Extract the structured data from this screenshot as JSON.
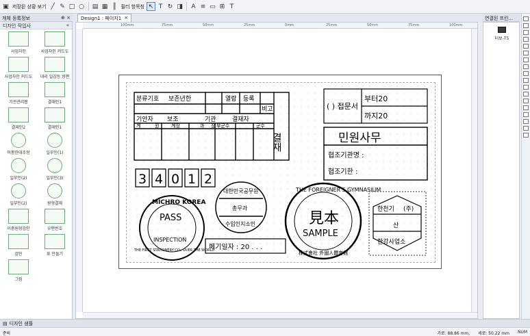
{
  "toolbar": {
    "stored_label": "저장된 상황 보기",
    "field_label": "필터 항목칭",
    "items": [
      "save-icon",
      "print-icon",
      "undo-icon",
      "line-icon",
      "pen-icon",
      "rect-icon",
      "roundrect-icon",
      "ellipse-icon",
      "image-icon",
      "table-icon",
      "barcode-icon",
      "pointer-icon",
      "text-icon",
      "rotate-icon",
      "fill-icon",
      "font-icon",
      "align-icon"
    ]
  },
  "left_panel": {
    "title": "개체 등록정보",
    "subtitle": "디자인 작업사",
    "items": [
      "사업자인",
      "사업자인 커드도",
      "사업자인 커드도",
      "대리 일감등 형편",
      "기관관리봉",
      "결재인1",
      "결재인2",
      "결재인1",
      "미봉한대조형",
      "일부인(1)",
      "일부인(2)",
      "일부인(3)",
      "일부인(2)",
      "원형결재",
      "이중원형검인",
      "우편번호",
      "검인",
      "표 만들기",
      "그림"
    ]
  },
  "doc_tab": {
    "label": "Design1 : 페이지1",
    "close": "×"
  },
  "ruler": [
    "100mm",
    "75mm",
    "50mm",
    "25mm",
    "0mm",
    "25mm",
    "50mm",
    "75mm",
    "100mm"
  ],
  "right_panel": {
    "title": "연결된 프린...",
    "device": "터보-T5"
  },
  "bottom": {
    "tab": "디자인 샘플"
  },
  "status": {
    "left": "준비",
    "coord_x": "가로: 88.86 mm,",
    "coord_y": "세로: 50.22 mm",
    "num": "NUM"
  },
  "stamps": {
    "t1_h": [
      "분류기호",
      "보존년한",
      "열람",
      "등록",
      "비고",
      "기안자",
      "보조",
      "기관",
      "결재자",
      "계",
      "원",
      "계장",
      "과",
      "장",
      "부군수",
      "군수"
    ],
    "kyul": "결재",
    "receipt": [
      "( ) 접문서",
      "부터20",
      "까지20"
    ],
    "minwon": "민원사무",
    "coop1": "협조기관명 :",
    "coop2": "협조기한 :",
    "digits": [
      "3",
      "4",
      "0",
      "1",
      "2"
    ],
    "mk": [
      "MICHRO KOREA",
      "PASS",
      "INSPECTION",
      "THE FIRST STATIONERY CO., OVER THE WORLD"
    ],
    "korea": [
      "대한민국공무원",
      "총무과",
      "수입인지소인"
    ],
    "sample": [
      "THE FOREIGNER'S GYMNASIUM",
      "見本",
      "SAMPLE",
      "株式會社 外國人體育館"
    ],
    "hexa": [
      "한천기",
      "산",
      "한강사업소",
      "(주)"
    ],
    "discard": "폐기일자 : 20 . . ."
  }
}
